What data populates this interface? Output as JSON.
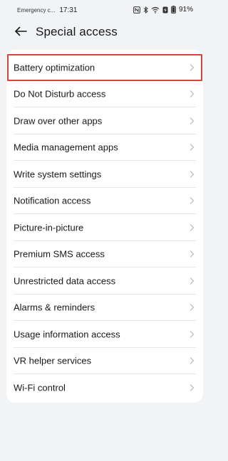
{
  "status_bar": {
    "carrier": "Emergency c...",
    "time": "17:31",
    "battery": "91%",
    "icons": [
      "nfc-icon",
      "bluetooth-icon",
      "wifi-icon",
      "battery-saver-icon",
      "battery-icon"
    ]
  },
  "header": {
    "back_icon": "arrow-left-icon",
    "title": "Special access"
  },
  "list": {
    "items": [
      {
        "label": "Battery optimization",
        "highlighted": true
      },
      {
        "label": "Do Not Disturb access"
      },
      {
        "label": "Draw over other apps"
      },
      {
        "label": "Media management apps"
      },
      {
        "label": "Write system settings"
      },
      {
        "label": "Notification access"
      },
      {
        "label": "Picture-in-picture"
      },
      {
        "label": "Premium SMS access"
      },
      {
        "label": "Unrestricted data access"
      },
      {
        "label": "Alarms & reminders"
      },
      {
        "label": "Usage information access"
      },
      {
        "label": "VR helper services"
      },
      {
        "label": "Wi-Fi control"
      }
    ]
  },
  "colors": {
    "background": "#f1f3f5",
    "card": "#ffffff",
    "highlight": "#d9433f",
    "chevron": "#b8b8b8"
  }
}
